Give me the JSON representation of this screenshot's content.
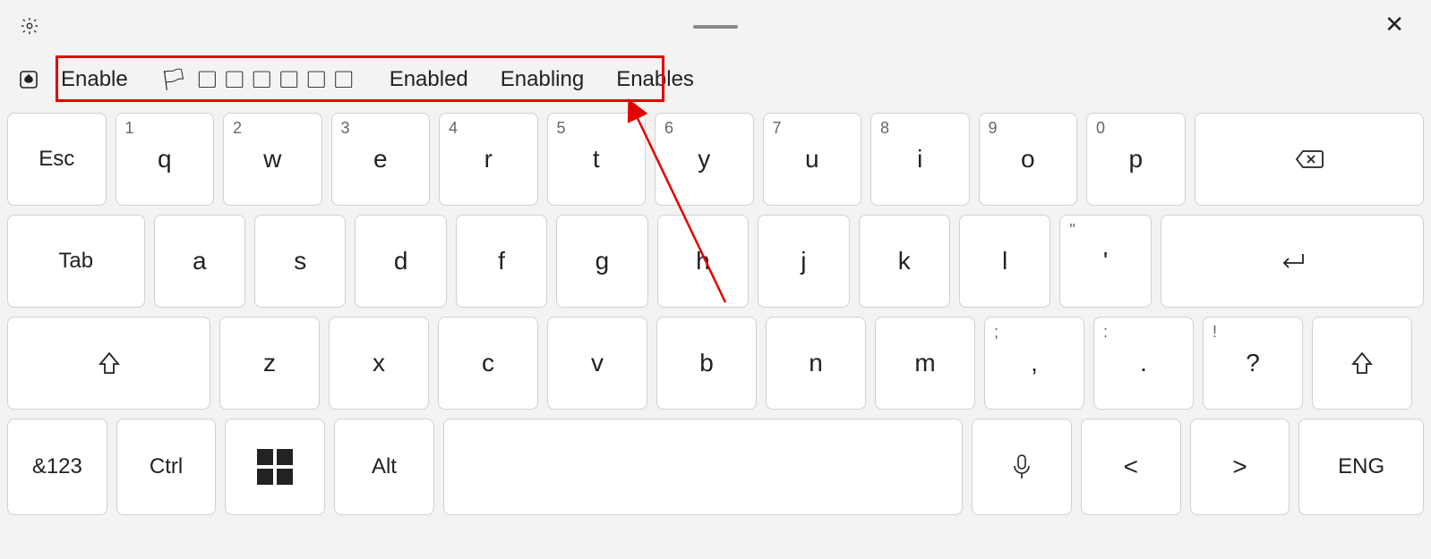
{
  "topbar": {
    "close_glyph": "✕"
  },
  "suggestions": {
    "items": [
      "Enable",
      "🏳 ◻◻◻◻◻◻",
      "Enabled",
      "Enabling",
      "Enables"
    ]
  },
  "row1": {
    "esc": "Esc",
    "keys": [
      {
        "main": "q",
        "sup": "1"
      },
      {
        "main": "w",
        "sup": "2"
      },
      {
        "main": "e",
        "sup": "3"
      },
      {
        "main": "r",
        "sup": "4"
      },
      {
        "main": "t",
        "sup": "5"
      },
      {
        "main": "y",
        "sup": "6"
      },
      {
        "main": "u",
        "sup": "7"
      },
      {
        "main": "i",
        "sup": "8"
      },
      {
        "main": "o",
        "sup": "9"
      },
      {
        "main": "p",
        "sup": "0"
      }
    ]
  },
  "row2": {
    "tab": "Tab",
    "keys": [
      {
        "main": "a"
      },
      {
        "main": "s"
      },
      {
        "main": "d"
      },
      {
        "main": "f"
      },
      {
        "main": "g"
      },
      {
        "main": "h"
      },
      {
        "main": "j"
      },
      {
        "main": "k"
      },
      {
        "main": "l"
      },
      {
        "main": "'",
        "sup": "\""
      }
    ]
  },
  "row3": {
    "keys": [
      {
        "main": "z"
      },
      {
        "main": "x"
      },
      {
        "main": "c"
      },
      {
        "main": "v"
      },
      {
        "main": "b"
      },
      {
        "main": "n"
      },
      {
        "main": "m"
      },
      {
        "main": ",",
        "sup": ";"
      },
      {
        "main": ".",
        "sup": ":"
      },
      {
        "main": "?",
        "sup": "!"
      }
    ]
  },
  "row4": {
    "sym": "&123",
    "ctrl": "Ctrl",
    "alt": "Alt",
    "left": "<",
    "right": ">",
    "lang": "ENG"
  }
}
